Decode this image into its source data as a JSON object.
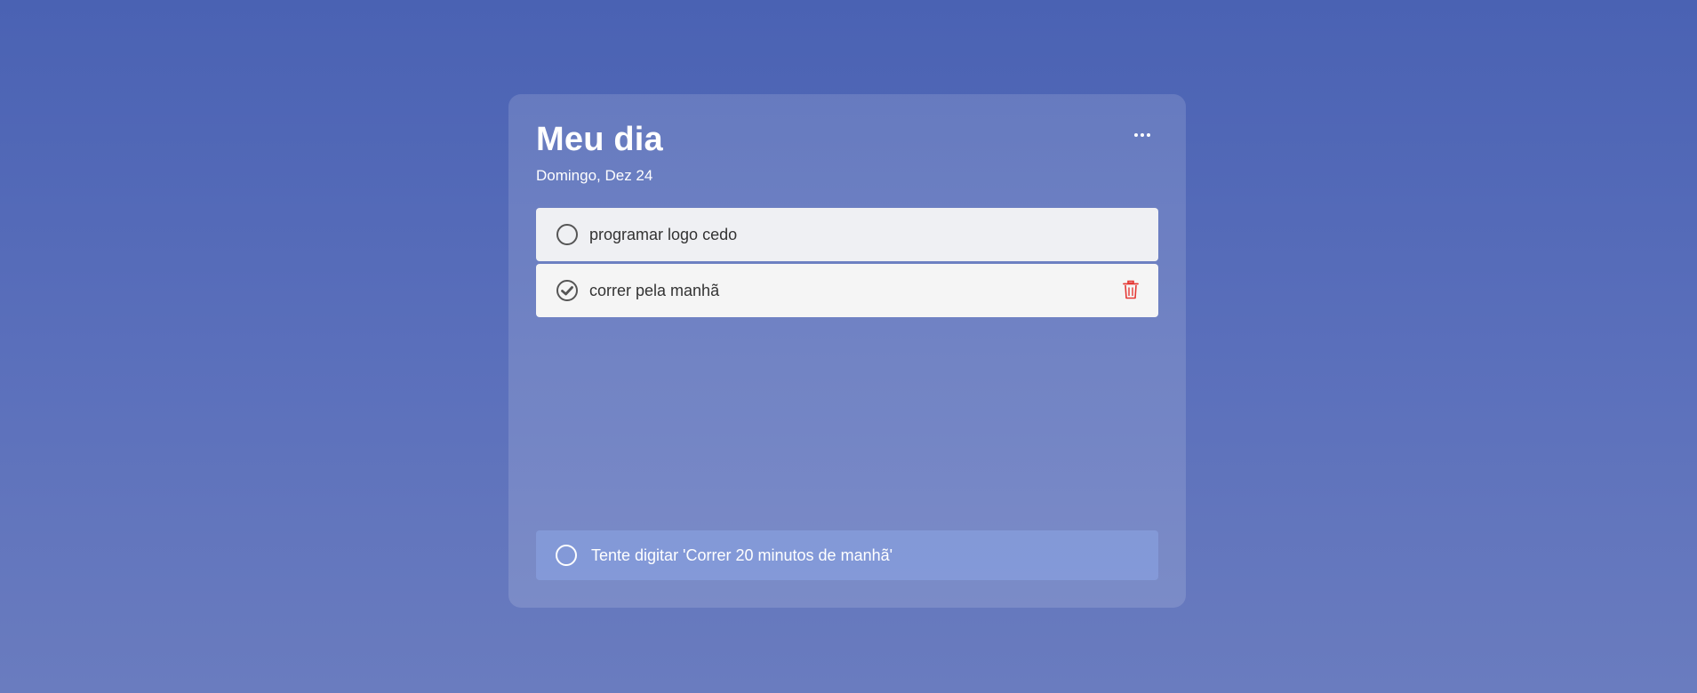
{
  "header": {
    "title": "Meu dia",
    "date": "Domingo, Dez 24",
    "menu_icon": "more-horizontal-icon"
  },
  "tasks": [
    {
      "label": "programar logo cedo",
      "completed": false,
      "icon": "circle-icon"
    },
    {
      "label": "correr pela manhã",
      "completed": true,
      "icon": "check-circle-icon",
      "action_icon": "trash-icon"
    }
  ],
  "new_task": {
    "placeholder": "Tente digitar 'Correr 20 minutos de manhã'",
    "value": ""
  },
  "colors": {
    "background": "#4a62b3",
    "delete": "#e53935",
    "task_text": "#333333"
  }
}
